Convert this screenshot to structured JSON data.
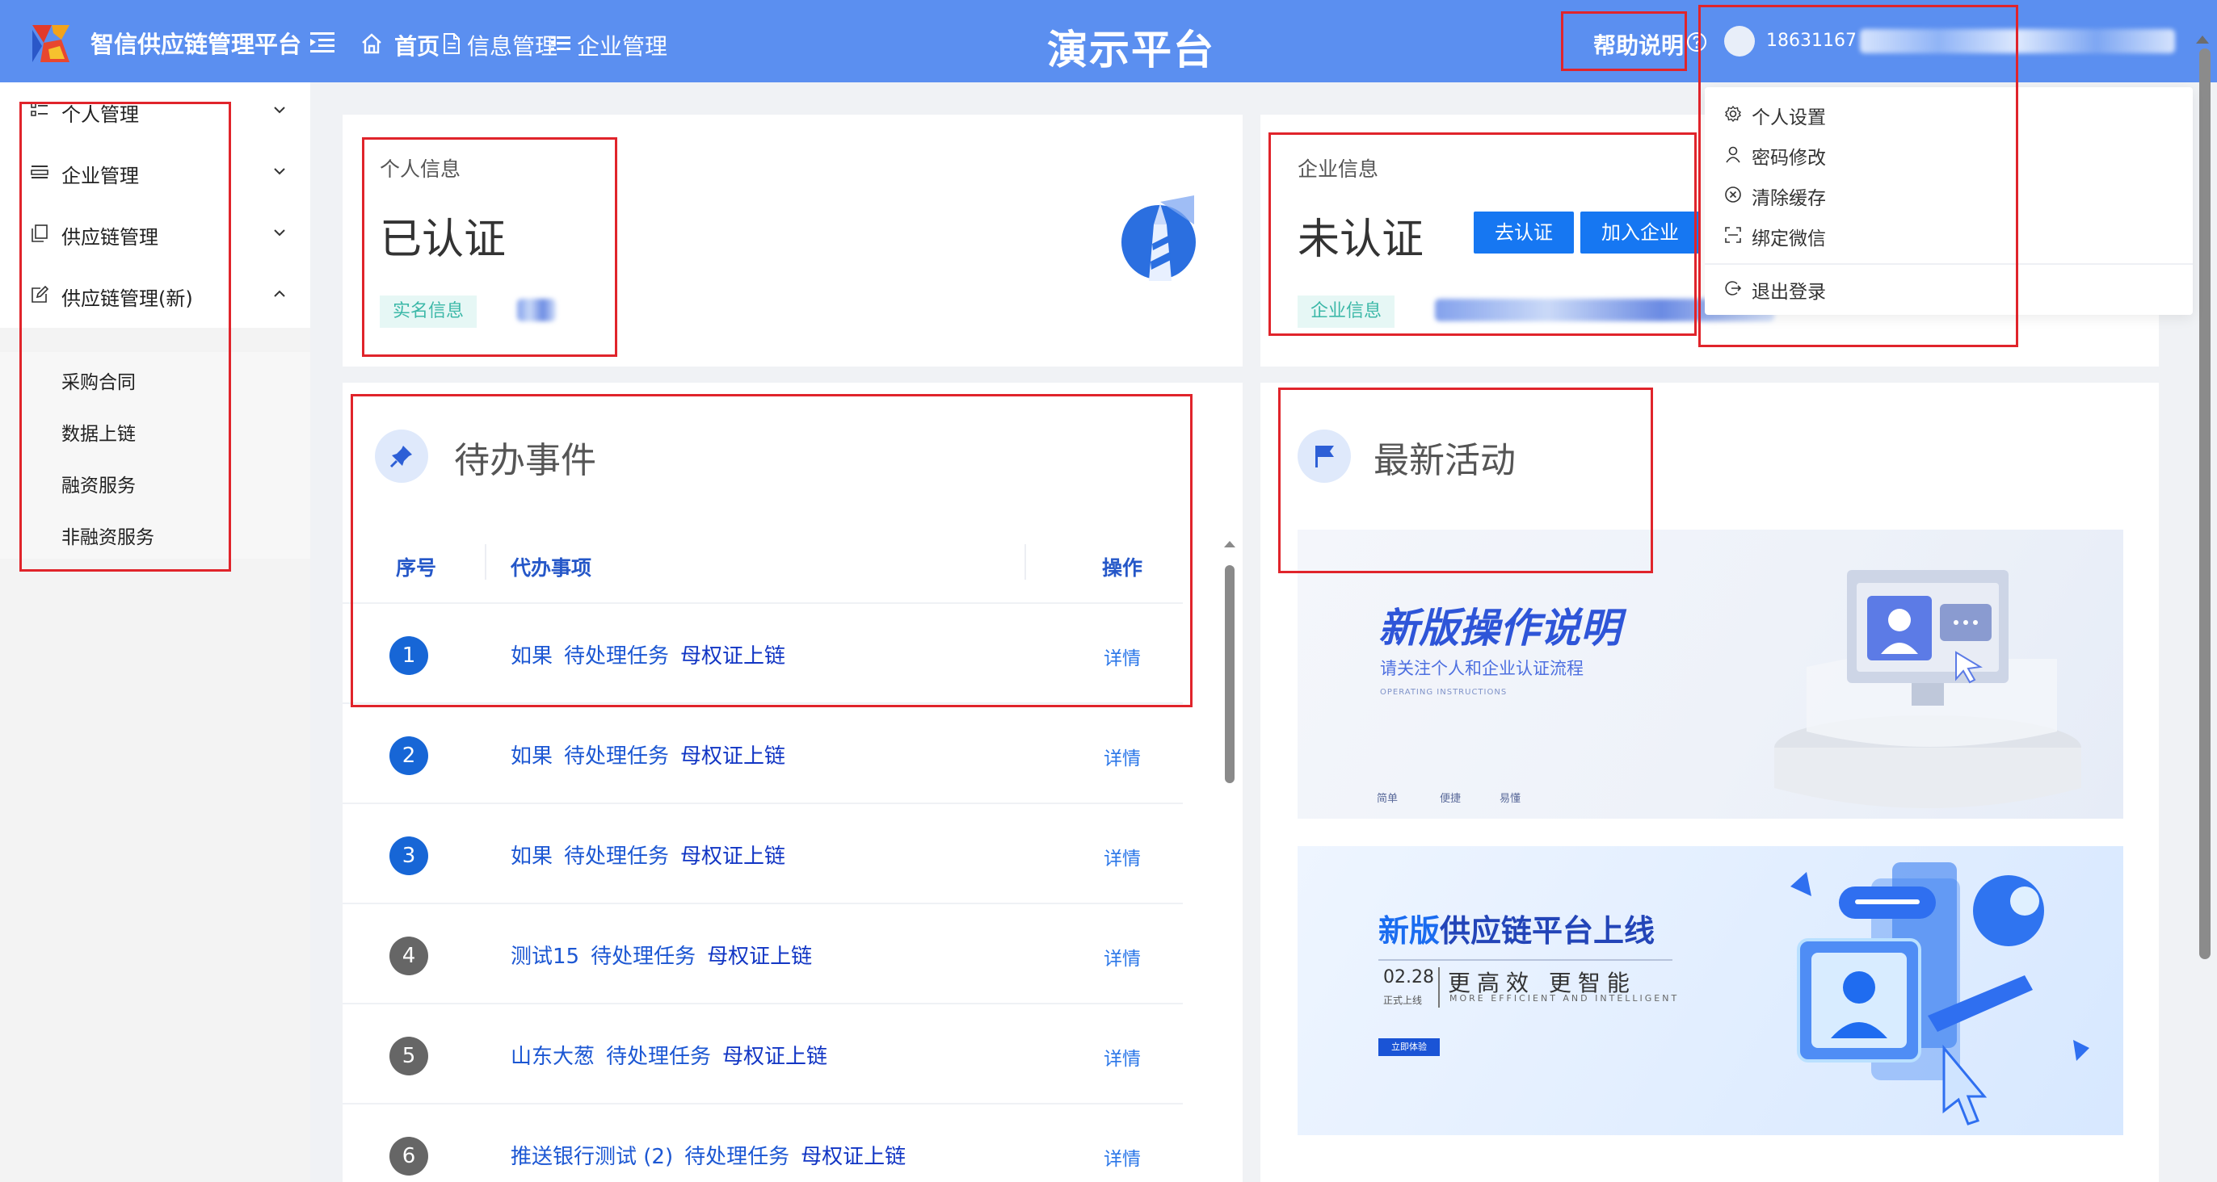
{
  "header": {
    "app_name": "智信供应链管理平台",
    "breadcrumb": {
      "home": "首页",
      "level2": "信息管理",
      "level3": "企业管理"
    },
    "center_title": "演示平台",
    "help_label": "帮助说明",
    "user_name_visible": "18631167"
  },
  "sidebar": {
    "items": [
      {
        "label": "个人管理",
        "icon": "grid-list-icon",
        "expanded": false
      },
      {
        "label": "企业管理",
        "icon": "list-card-icon",
        "expanded": false
      },
      {
        "label": "供应链管理",
        "icon": "copy-doc-icon",
        "expanded": false
      },
      {
        "label": "供应链管理(新)",
        "icon": "edit-doc-icon",
        "expanded": true
      }
    ],
    "subitems": [
      "采购合同",
      "数据上链",
      "融资服务",
      "非融资服务"
    ]
  },
  "personal_card": {
    "subtitle": "个人信息",
    "status": "已认证",
    "tag": "实名信息"
  },
  "company_card": {
    "subtitle": "企业信息",
    "status": "未认证",
    "btn_certify": "去认证",
    "btn_join": "加入企业",
    "tag": "企业信息"
  },
  "todo": {
    "title": "待办事件",
    "columns": [
      "序号",
      "代办事项",
      "操作"
    ],
    "rows": [
      {
        "no": "1",
        "name": "如果",
        "task": "待处理任务",
        "type": "母权证上链",
        "action": "详情",
        "color": "blue"
      },
      {
        "no": "2",
        "name": "如果",
        "task": "待处理任务",
        "type": "母权证上链",
        "action": "详情",
        "color": "blue"
      },
      {
        "no": "3",
        "name": "如果",
        "task": "待处理任务",
        "type": "母权证上链",
        "action": "详情",
        "color": "blue"
      },
      {
        "no": "4",
        "name": "测试15",
        "task": "待处理任务",
        "type": "母权证上链",
        "action": "详情",
        "color": "gray"
      },
      {
        "no": "5",
        "name": "山东大葱",
        "task": "待处理任务",
        "type": "母权证上链",
        "action": "详情",
        "color": "gray"
      },
      {
        "no": "6",
        "name": "推送银行测试 (2)",
        "task": "待处理任务",
        "type": "母权证上链",
        "action": "详情",
        "color": "gray"
      }
    ]
  },
  "activity": {
    "title": "最新活动",
    "banner1": {
      "title": "新版操作说明",
      "subtitle": "请关注个人和企业认证流程",
      "tiny": "OPERATING INSTRUCTIONS",
      "meta": [
        "简单",
        "便捷",
        "易懂"
      ]
    },
    "banner2": {
      "title_highlight": "新版",
      "title_rest": "供应链平台上线",
      "date": "02.28",
      "date_sub": "正式上线",
      "slogan": "更高效 更智能",
      "slogan_en": "MORE EFFICIENT AND INTELLIGENT",
      "button": "立即体验"
    }
  },
  "dropdown": {
    "items": [
      {
        "label": "个人设置",
        "icon": "gear-icon"
      },
      {
        "label": "密码修改",
        "icon": "user-icon"
      },
      {
        "label": "清除缓存",
        "icon": "clear-circle-icon"
      },
      {
        "label": "绑定微信",
        "icon": "scan-icon"
      },
      {
        "label": "退出登录",
        "icon": "logout-icon"
      }
    ]
  },
  "colors": {
    "header_bg": "#5b8ff0",
    "primary": "#1677f2",
    "link": "#1c57d3",
    "tag_text": "#3cb8a8",
    "annotation": "#e0242b"
  }
}
